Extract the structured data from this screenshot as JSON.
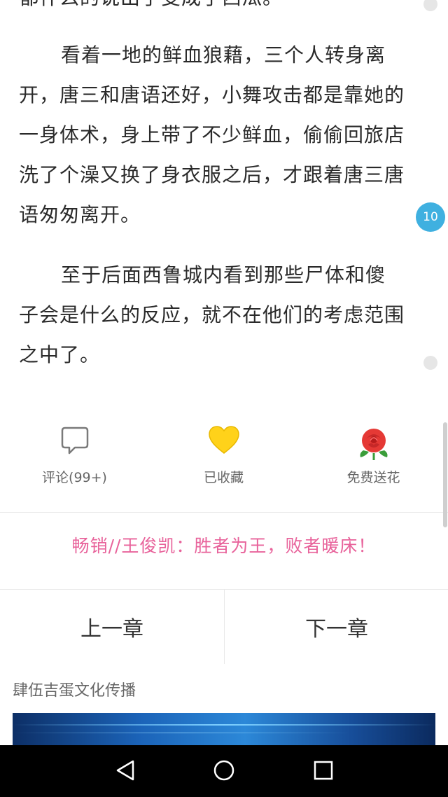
{
  "reader": {
    "cut_line": "都什么的说出了变成了西瓜。",
    "paragraph_1": "看着一地的鲜血狼藉，三个人转身离开，唐三和唐语还好，小舞攻击都是靠她的一身体术，身上带了不少鲜血，偷偷回旅店洗了个澡又换了身衣服之后，才跟着唐三唐语匆匆离开。",
    "paragraph_2": "至于后面西鲁城内看到那些尸体和傻子会是什么的反应，就不在他们的考虑范围之中了。",
    "comment_count_badge": "10"
  },
  "actions": {
    "comment_label": "评论(99+)",
    "favorite_label": "已收藏",
    "flower_label": "免费送花"
  },
  "promo": {
    "text": "畅销//王俊凯：胜者为王，败者暖床！"
  },
  "chapters": {
    "prev_label": "上一章",
    "next_label": "下一章"
  },
  "source": {
    "name": "肆伍吉蛋文化传播"
  },
  "icons": {
    "comment": "speech-bubble-icon",
    "favorite": "heart-icon",
    "flower": "rose-icon",
    "back": "back-triangle-icon",
    "home": "home-circle-icon",
    "recent": "recent-square-icon"
  },
  "colors": {
    "badge": "#3fb0e0",
    "promo": "#e8639b",
    "heart": "#ffd21a",
    "rose": "#e53935"
  }
}
